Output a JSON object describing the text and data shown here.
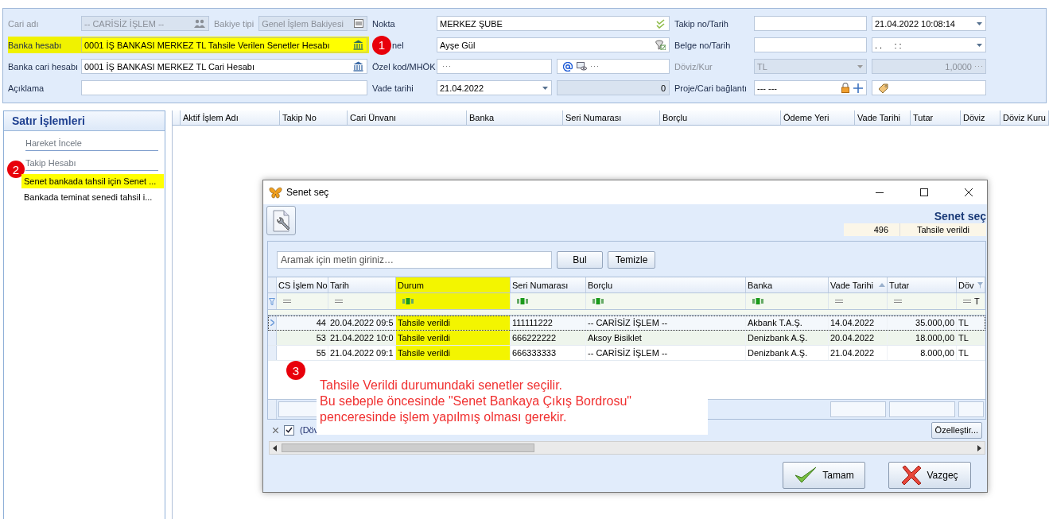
{
  "form": {
    "badge": "1",
    "cari_adi": {
      "label": "Cari adı",
      "value": "-- CARİSİZ İŞLEM --",
      "disabled": true
    },
    "bakiye_tipi": {
      "label": "Bakiye tipi",
      "value": "Genel İşlem Bakiyesi",
      "disabled": true
    },
    "nokta": {
      "label": "Nokta",
      "value": "MERKEZ ŞUBE"
    },
    "takip": {
      "label": "Takip no/Tarih",
      "date": "21.04.2022 10:08:14"
    },
    "banka_hesabi": {
      "label": "Banka hesabı",
      "value": "0001 İŞ BANKASI MERKEZ TL Tahsile Verilen Senetler Hesabı",
      "highlighted": true
    },
    "personel": {
      "label": "nel",
      "value": "Ayşe Gül"
    },
    "belge": {
      "label": "Belge no/Tarih",
      "date": ". .     : :"
    },
    "banka_cari": {
      "label": "Banka cari hesabı",
      "value": "0001 İŞ BANKASI MERKEZ TL Cari Hesabı"
    },
    "ozel_kod": {
      "label": "Özel kod/MHÖK"
    },
    "doviz": {
      "label": "Döviz/Kur",
      "currency": "TL",
      "rate": "1,0000",
      "disabled": true
    },
    "aciklama": {
      "label": "Açıklama"
    },
    "vade": {
      "label": "Vade tarihi",
      "date": "21.04.2022",
      "amount": "0",
      "amount_disabled": true
    },
    "proje": {
      "label": "Proje/Cari bağlantı",
      "value": "--- ---"
    }
  },
  "sidebar": {
    "title": "Satır İşlemleri",
    "items": [
      {
        "label": "Hareket İncele",
        "kind": "header",
        "highlighted": false
      },
      {
        "label": "Takip Hesabı",
        "kind": "header",
        "highlighted": false,
        "badge": "2"
      },
      {
        "label": "Senet bankada tahsil için Senet ...",
        "kind": "link",
        "highlighted": true
      },
      {
        "label": "Bankada teminat senedi tahsil i...",
        "kind": "link",
        "highlighted": false
      }
    ]
  },
  "main_grid": {
    "columns": [
      "Aktif İşlem Adı",
      "Takip No",
      "Cari Ünvanı",
      "Banka",
      "Seri Numarası",
      "Borçlu",
      "Ödeme Yeri",
      "Vade Tarihi",
      "Tutar",
      "Döviz",
      "Döviz Kuru"
    ]
  },
  "dialog": {
    "title": "Senet seç",
    "header_title": "Senet seç",
    "count": "496",
    "status": "Tahsile verildi",
    "search": {
      "placeholder": "Aramak için metin giriniz…"
    },
    "find_button": "Bul",
    "clear_button": "Temizle",
    "columns": [
      {
        "label": "CS İşlem No",
        "kind": "number",
        "text_filter": false,
        "highlighted": false
      },
      {
        "label": "Tarih",
        "kind": "text",
        "text_filter": false,
        "highlighted": false
      },
      {
        "label": "Durum",
        "kind": "text",
        "text_filter": true,
        "highlighted": true
      },
      {
        "label": "Seri Numarası",
        "kind": "text",
        "text_filter": true,
        "highlighted": false
      },
      {
        "label": "Borçlu",
        "kind": "text",
        "text_filter": true,
        "highlighted": false
      },
      {
        "label": "Banka",
        "kind": "text",
        "text_filter": true,
        "highlighted": false
      },
      {
        "label": "Vade Tarihi",
        "kind": "text",
        "text_filter": false,
        "highlighted": false,
        "sorted": true
      },
      {
        "label": "Tutar",
        "kind": "number",
        "text_filter": false,
        "highlighted": false
      },
      {
        "label": "Döv",
        "kind": "text",
        "text_filter": false,
        "highlighted": false,
        "filtered": true,
        "filter_text": "T"
      }
    ],
    "rows": [
      {
        "selected": true,
        "cells": [
          "44",
          "20.04.2022 09:5",
          "Tahsile verildi",
          "111111222",
          "-- CARİSİZ İŞLEM --",
          "Akbank T.A.Ş.",
          "14.04.2022",
          "35.000,00",
          "TL"
        ]
      },
      {
        "selected": false,
        "cells": [
          "53",
          "21.04.2022 10:0",
          "Tahsile verildi",
          "666222222",
          "Aksoy Bisiklet",
          "Denizbank A.Ş.",
          "20.04.2022",
          "18.000,00",
          "TL"
        ]
      },
      {
        "selected": false,
        "cells": [
          "55",
          "21.04.2022 09:1",
          "Tahsile verildi",
          "666333333",
          "-- CARİSİZ İŞLEM --",
          "Denizbank A.Ş.",
          "21.04.2022",
          "8.000,00",
          "TL"
        ]
      }
    ],
    "filter_bar": {
      "checked": true,
      "text": "(Döv"
    },
    "customize_button": "Özelleştir...",
    "ok_button": "Tamam",
    "cancel_button": "Vazgeç"
  },
  "annotation": {
    "badge": "3",
    "text": "Tahsile Verildi durumundaki senetler seçilir.\nBu sebeple öncesinde \"Senet Bankaya Çıkış Bordrosu\"\npenceresinde işlem yapılmış olması gerekir."
  }
}
